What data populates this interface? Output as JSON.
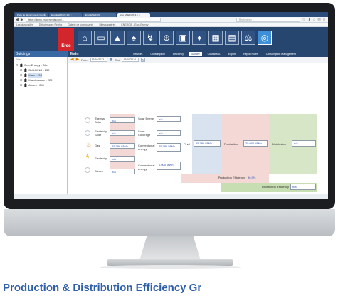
{
  "browser": {
    "tabs": [
      {
        "label": "Page de démarrage de Mozilla"
      },
      {
        "label": "Erco ENERGIS 3.0"
      },
      {
        "label": "Erco ENERGIS"
      },
      {
        "label": "Erco ENERGIS 3.0",
        "active": true
      }
    ],
    "url": "https://demo.ercoenergis.com/...",
    "search_placeholder": "Rechercher",
    "bookmarks": [
      "Les plus visités",
      "Débuter avec Firefox",
      "Galerie de composants",
      "Sites suggérés",
      "ENERGIS - Erco Energy"
    ]
  },
  "app": {
    "logo": "Erco",
    "icons": [
      {
        "name": "home-icon",
        "glyph": "⌂"
      },
      {
        "name": "monitor-icon",
        "glyph": "▭"
      },
      {
        "name": "buildings-icon",
        "glyph": "▲"
      },
      {
        "name": "bell-icon",
        "glyph": "♠"
      },
      {
        "name": "pulse-icon",
        "glyph": "↯"
      },
      {
        "name": "network-icon",
        "glyph": "⊕"
      },
      {
        "name": "folder-icon",
        "glyph": "▣"
      },
      {
        "name": "map-pin-icon",
        "glyph": "♦"
      },
      {
        "name": "calculator-icon",
        "glyph": "▦"
      },
      {
        "name": "report-icon",
        "glyph": "▤"
      },
      {
        "name": "balance-icon",
        "glyph": "⚖"
      },
      {
        "name": "efficiency-icon",
        "glyph": "◎",
        "selected": true
      }
    ]
  },
  "sidebar": {
    "title": "Buildings",
    "filter_label": "Filter",
    "tree": [
      {
        "label": "Erco Energy - Site",
        "level": 1,
        "toggle": "⊟"
      },
      {
        "label": "BUILDING - 230",
        "level": 2,
        "toggle": "⊞"
      },
      {
        "label": "Main - 210",
        "level": 2,
        "toggle": "⊞",
        "selected": true
      },
      {
        "label": "Maintenance - 220",
        "level": 2,
        "toggle": "⊞"
      },
      {
        "label": "Annex - 240",
        "level": 2,
        "toggle": "⊞"
      }
    ]
  },
  "view": {
    "title": "Main",
    "tabs": [
      {
        "label": "Services"
      },
      {
        "label": "Consumption"
      },
      {
        "label": "Efficiency"
      },
      {
        "label": "Sankey",
        "active": true
      },
      {
        "label": "Cost Break."
      },
      {
        "label": "Export"
      },
      {
        "label": "Report Notes"
      },
      {
        "label": "Consumption Management"
      }
    ]
  },
  "toolbar": {
    "from_label": "From",
    "from_value": "16/10/2013",
    "to_label": "End",
    "to_value": "16/10/2014"
  },
  "diagram": {
    "sources": [
      {
        "label": "Thermal Solar",
        "value": "n/a",
        "output_label": "Solar Energy",
        "output_value": "n/a"
      },
      {
        "label": "Electricity Solar",
        "value": "n/a",
        "output_label": "Solar Coverage",
        "output_value": "n/a"
      },
      {
        "label": "Gas",
        "value": "25,788 MWh",
        "output_label": "Conventional energy",
        "output_value": "25,788 MWh"
      },
      {
        "label": "Electricity",
        "value": "n/a"
      },
      {
        "label": "Steam",
        "value": "n/a",
        "output_label": "Conventional energy",
        "output_value": "0.000 MWh"
      }
    ],
    "final_label": "Final",
    "final_value": "25.788 MWh",
    "production_label": "Production",
    "production_value": "25.000 MWh",
    "distribution_label": "Distribution",
    "distribution_value": "n/a",
    "production_efficiency_label": "Production Efficiency",
    "production_efficiency_value": "96.9%",
    "distribution_efficiency_label": "Distribution Efficiency",
    "distribution_efficiency_value": "n/a"
  },
  "caption": "Production & Distribution Efficiency Gr"
}
